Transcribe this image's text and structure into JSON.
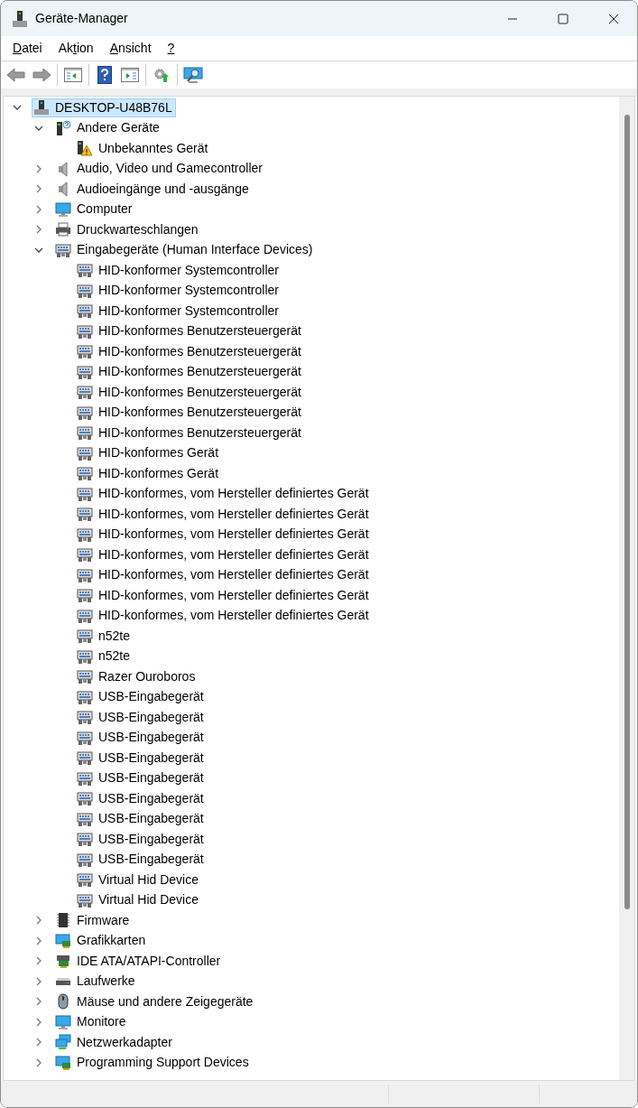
{
  "window": {
    "title": "Geräte-Manager"
  },
  "menu": [
    {
      "key": "D",
      "after": "atei"
    },
    {
      "before": "Ak",
      "key": "t",
      "after": "ion"
    },
    {
      "key": "A",
      "after": "nsicht"
    },
    {
      "key": "?"
    }
  ],
  "tree": {
    "label": "DESKTOP-U48B76L",
    "kind": "computer-node",
    "selected": true,
    "expanded": true,
    "children": [
      {
        "label": "Andere Geräte",
        "kind": "unknown",
        "expanded": true,
        "children": [
          {
            "label": "Unbekanntes Gerät",
            "kind": "warning-device"
          }
        ]
      },
      {
        "label": "Audio, Video und Gamecontroller",
        "kind": "speaker",
        "expanded": false
      },
      {
        "label": "Audioeingänge und -ausgänge",
        "kind": "speaker",
        "expanded": false
      },
      {
        "label": "Computer",
        "kind": "monitor",
        "expanded": false
      },
      {
        "label": "Druckwarteschlangen",
        "kind": "printer",
        "expanded": false
      },
      {
        "label": "Eingabegeräte (Human Interface Devices)",
        "kind": "hid",
        "expanded": true,
        "children": [
          {
            "label": "HID-konformer Systemcontroller",
            "kind": "hid"
          },
          {
            "label": "HID-konformer Systemcontroller",
            "kind": "hid"
          },
          {
            "label": "HID-konformer Systemcontroller",
            "kind": "hid"
          },
          {
            "label": "HID-konformes Benutzersteuergerät",
            "kind": "hid"
          },
          {
            "label": "HID-konformes Benutzersteuergerät",
            "kind": "hid"
          },
          {
            "label": "HID-konformes Benutzersteuergerät",
            "kind": "hid"
          },
          {
            "label": "HID-konformes Benutzersteuergerät",
            "kind": "hid"
          },
          {
            "label": "HID-konformes Benutzersteuergerät",
            "kind": "hid"
          },
          {
            "label": "HID-konformes Benutzersteuergerät",
            "kind": "hid"
          },
          {
            "label": "HID-konformes Gerät",
            "kind": "hid"
          },
          {
            "label": "HID-konformes Gerät",
            "kind": "hid"
          },
          {
            "label": "HID-konformes, vom Hersteller definiertes Gerät",
            "kind": "hid"
          },
          {
            "label": "HID-konformes, vom Hersteller definiertes Gerät",
            "kind": "hid"
          },
          {
            "label": "HID-konformes, vom Hersteller definiertes Gerät",
            "kind": "hid"
          },
          {
            "label": "HID-konformes, vom Hersteller definiertes Gerät",
            "kind": "hid"
          },
          {
            "label": "HID-konformes, vom Hersteller definiertes Gerät",
            "kind": "hid"
          },
          {
            "label": "HID-konformes, vom Hersteller definiertes Gerät",
            "kind": "hid"
          },
          {
            "label": "HID-konformes, vom Hersteller definiertes Gerät",
            "kind": "hid"
          },
          {
            "label": "n52te",
            "kind": "hid"
          },
          {
            "label": "n52te",
            "kind": "hid"
          },
          {
            "label": "Razer Ouroboros",
            "kind": "hid"
          },
          {
            "label": "USB-Eingabegerät",
            "kind": "hid"
          },
          {
            "label": "USB-Eingabegerät",
            "kind": "hid"
          },
          {
            "label": "USB-Eingabegerät",
            "kind": "hid"
          },
          {
            "label": "USB-Eingabegerät",
            "kind": "hid"
          },
          {
            "label": "USB-Eingabegerät",
            "kind": "hid"
          },
          {
            "label": "USB-Eingabegerät",
            "kind": "hid"
          },
          {
            "label": "USB-Eingabegerät",
            "kind": "hid"
          },
          {
            "label": "USB-Eingabegerät",
            "kind": "hid"
          },
          {
            "label": "USB-Eingabegerät",
            "kind": "hid"
          },
          {
            "label": "Virtual Hid Device",
            "kind": "hid"
          },
          {
            "label": "Virtual Hid Device",
            "kind": "hid"
          }
        ]
      },
      {
        "label": "Firmware",
        "kind": "chip",
        "expanded": false
      },
      {
        "label": "Grafikkarten",
        "kind": "display-card",
        "expanded": false
      },
      {
        "label": "IDE ATA/ATAPI-Controller",
        "kind": "controller",
        "expanded": false
      },
      {
        "label": "Laufwerke",
        "kind": "drive",
        "expanded": false
      },
      {
        "label": "Mäuse und andere Zeigegeräte",
        "kind": "mouse",
        "expanded": false
      },
      {
        "label": "Monitore",
        "kind": "monitor",
        "expanded": false
      },
      {
        "label": "Netzwerkadapter",
        "kind": "network",
        "expanded": false
      },
      {
        "label": "Programming Support Devices",
        "kind": "display-card",
        "expanded": false
      }
    ]
  }
}
